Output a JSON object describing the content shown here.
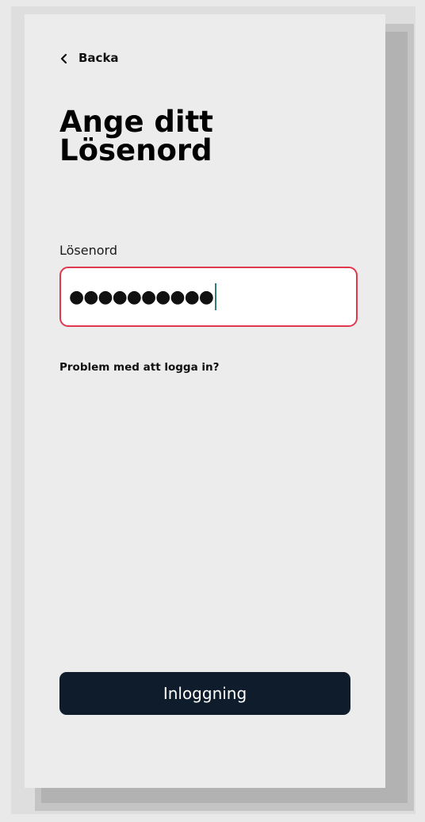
{
  "header": {
    "back_label": "Backa",
    "back_icon": "chevron-left-icon"
  },
  "title": "Ange ditt Lösenord",
  "password_field": {
    "label": "Lösenord",
    "value": "●●●●●●●●●●",
    "border_color": "#e0394e",
    "caret_color": "#2f7d77"
  },
  "help_link": "Problem med att logga in?",
  "login_button": {
    "label": "Inloggning",
    "color": "#0e1c2b"
  }
}
